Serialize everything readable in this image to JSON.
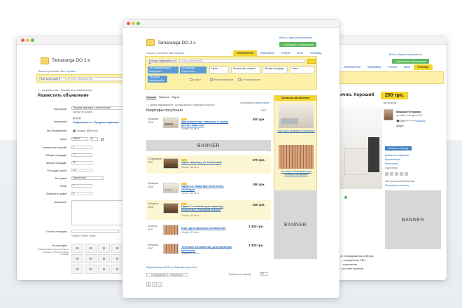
{
  "left": {
    "site_name": "Tamaranga DO 2.x",
    "search_region_label": "Поиск в регионе:",
    "search_region_link": "Все страны",
    "category_select": "Все категории ▾",
    "search_placeholder": "Поиск объявлений...",
    "breadcrumb": "⌂ › Объявления › Разместить объявление",
    "title": "Разместить объявление",
    "labels": [
      "Заголовок*",
      "Категория*",
      "Тип объявления*",
      "Цена*",
      "Количество комнат*",
      "Общая площадь*",
      "Жилая площадь*",
      "Площадь кухни*",
      "Тип дома*",
      "Этаж*",
      "Этажность дома*",
      "Описание*"
    ],
    "field_values": {
      "title": "Продам квартиру в новостройке",
      "title_hint": "вы еще не указали",
      "category": "Недвижимость » Продажа недвижим",
      "offer_sell": "Продам",
      "offer_buy": "Куплю",
      "price": "45000",
      "currency": "$",
      "rooms": "3",
      "total_area": "77",
      "living_area": "32",
      "kitchen_area": "14",
      "house_type": "Кирпичный",
      "floor": "2",
      "floors_total": "5"
    },
    "video_label": "Ссылка на видео",
    "video_hint": "Youtube, Rutube, Vimeo",
    "photos_label": "Фотографии",
    "photos_hint": "Объявления с фото получают в среднем в 3-5 раз больше откликов"
  },
  "center": {
    "site_name": "Tamaranga DO 2.x",
    "login": "Войти",
    "register": "Зарегистрироваться",
    "add_button": "+ Добавить объявление",
    "search_region_label": "Поиск в регионе:",
    "search_region_link": "Все страны",
    "nav": [
      "Объявление",
      "Магазины",
      "Услуги",
      "Блог",
      "Помощь"
    ],
    "category_select": "Аренда недвижимости ▾",
    "search_placeholder": "Поиск объявлений...",
    "filters": {
      "chip1": "Тип недвижимости",
      "chip1_val": "Квартира ▾",
      "chip2": "Тип аренды",
      "chip2_val": "Посуточно ▾",
      "price": "Цена",
      "rooms": "Количество комнат",
      "area": "Жилая площадь",
      "other": "Этаж",
      "house": "Тип дома",
      "house_val": "Кирпичный ▾",
      "with_photo": "с фото",
      "no_brokers": "Без посредников",
      "from_owner": "От посредников"
    },
    "tabs": [
      "Список",
      "Галерея",
      "Карта"
    ],
    "breadcrumb": "⌂ › Аренда недвижимости › Аренда квартир › Квартиры посуточно",
    "heading": "Квартиры посуточно",
    "sort_label": "Сортировка",
    "sort_value": "Самые новые",
    "rss_link": "RSS",
    "banner_text": "BANNER",
    "listings": [
      {
        "date": "28 марта 2016",
        "title": "Двухкомнатная квартира в самом центре Барселы",
        "price": "400 грн.",
        "sub": "3 комн., 60 кв.м."
      },
      {
        "date": "14 февраля 2017",
        "title": "Сдам квартиру на Советской",
        "price": "575 грн.",
        "sub": "3 комн., 56 кв.м."
      },
      {
        "date": "28 марта 2015",
        "title": "Сдам 2-х, квартиру посуточно, свободна",
        "price": "380 грн.",
        "sub": "3 комн., 60 кв.м."
      },
      {
        "date": "28 марта 2015",
        "title": "Сдаю 2-х комнатную квартиру посуточно, Хороший ремонт",
        "price": "200 грн.",
        "sub": "2 комн., 45 кв.м."
      },
      {
        "date": "15 июня 2017",
        "title": "Ещё одно премиум объявление",
        "price": "3 333 грн.",
        "sub": "3 комн., 60 кв.м."
      },
      {
        "date": "28 марта 2017",
        "title": "Тестовое объявление для проверки премиума",
        "price": "3 333 грн.",
        "sub": "3 комн., 60 кв.м."
      }
    ],
    "premium_head": "Премиум объявление",
    "premium_items": [
      "Ещё одно премиум объявление",
      "Тестовое объявление для проверки премиума"
    ],
    "side_banner": "BANNER",
    "rss_subscribe": "Подписка через RSS на \"Квартиры посуточно\"",
    "prev": "← Предыдущая",
    "next": "Следующая →",
    "per_page_label": "Перейти на страницу",
    "per_page_value": "50",
    "pages": [
      "1",
      "2",
      "3"
    ]
  },
  "right": {
    "login": "Войти",
    "register": "Зарегистрироваться",
    "add_button": "+ Добавить объявление",
    "nav": [
      "Объявление",
      "Магазины",
      "Услуги",
      "Блог",
      "Помощь"
    ],
    "title_fragment": "очно. Хороший",
    "price": "200 грн.",
    "price_sub": "Договорная",
    "seller_name": "Максим Петрович",
    "seller_since": "на сайте с 16 марта 2016",
    "phone": "063 *** ** **",
    "phone_show": "показать",
    "skype": "Skype",
    "msg_button": "Написать автору",
    "links": [
      "Добавить в избранное",
      "Пожаловаться",
      "Распечатать",
      "Поделиться"
    ],
    "stats": "430 просмотров объявления",
    "stats_link": "Посмотреть статистику",
    "banner_text": "BANNER",
    "desc_lines": [
      "2х, оборудованная мебелью",
      "..., холодильник, СВЧ,",
      "... погрузочная",
      "...ка: Киев Чернигов"
    ]
  }
}
